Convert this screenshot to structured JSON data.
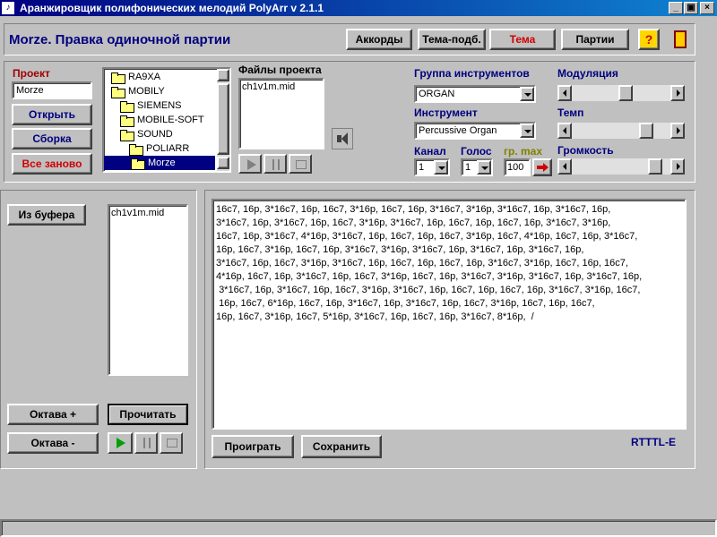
{
  "window": {
    "title": "Аранжировщик полифонических мелодий PolyArr  v 2.1.1",
    "controls": {
      "minimize": "_",
      "restore": "▣",
      "close": "×"
    }
  },
  "header": {
    "title": "Morze. Правка одиночной партии",
    "buttons": {
      "chords": "Аккорды",
      "theme_match": "Тема-подб.",
      "theme": "Тема",
      "parts": "Партии",
      "help": "?"
    }
  },
  "project": {
    "label": "Проект",
    "name_value": "Morze",
    "open": "Открыть",
    "build": "Сборка",
    "restart": "Все заново",
    "tree": [
      "RA9XA",
      "MOBILY",
      "SIEMENS",
      "MOBILE-SOFT",
      "SOUND",
      "POLIARR",
      "Morze"
    ],
    "files_label": "Файлы проекта",
    "files": [
      "ch1v1m.mid"
    ]
  },
  "instrument": {
    "group_label": "Группа инструментов",
    "group_value": "ORGAN",
    "instrument_label": "Инструмент",
    "instrument_value": "Percussive Organ",
    "channel_label": "Канал",
    "channel_value": "1",
    "voice_label": "Голос",
    "voice_value": "1",
    "max_label": "гр. max",
    "max_value": "100",
    "modulation_label": "Модуляция",
    "modulation_level": 0.55,
    "tempo_label": "Темп",
    "tempo_level": 0.8,
    "volume_label": "Громкость",
    "volume_level": 0.9
  },
  "left": {
    "from_buffer": "Из буфера",
    "files": [
      "ch1v1m.mid"
    ],
    "octave_up": "Октава +",
    "octave_down": "Октава -",
    "read": "Прочитать"
  },
  "editor": {
    "text": "16c7, 16p, 3*16c7, 16p, 16c7, 3*16p, 16c7, 16p, 3*16c7, 3*16p, 3*16c7, 16p, 3*16c7, 16p,\n3*16c7, 16p, 3*16c7, 16p, 16c7, 3*16p, 3*16c7, 16p, 16c7, 16p, 16c7, 16p, 3*16c7, 3*16p,\n16c7, 16p, 3*16c7, 4*16p, 3*16c7, 16p, 16c7, 16p, 16c7, 3*16p, 16c7, 4*16p, 16c7, 16p, 3*16c7,\n16p, 16c7, 3*16p, 16c7, 16p, 3*16c7, 3*16p, 3*16c7, 16p, 3*16c7, 16p, 3*16c7, 16p,\n3*16c7, 16p, 16c7, 3*16p, 3*16c7, 16p, 16c7, 16p, 16c7, 16p, 3*16c7, 3*16p, 16c7, 16p, 16c7,\n4*16p, 16c7, 16p, 3*16c7, 16p, 16c7, 3*16p, 16c7, 16p, 3*16c7, 3*16p, 3*16c7, 16p, 3*16c7, 16p,\n 3*16c7, 16p, 3*16c7, 16p, 16c7, 3*16p, 3*16c7, 16p, 16c7, 16p, 16c7, 16p, 3*16c7, 3*16p, 16c7,\n 16p, 16c7, 6*16p, 16c7, 16p, 3*16c7, 16p, 3*16c7, 16p, 16c7, 3*16p, 16c7, 16p, 16c7,\n16p, 16c7, 3*16p, 16c7, 5*16p, 3*16c7, 16p, 16c7, 16p, 3*16c7, 8*16p,  /",
    "play": "Проиграть",
    "save": "Сохранить",
    "format": "RTTTL-E"
  },
  "colors": {
    "title_start": "#000080",
    "title_end": "#1084d0",
    "accent_red": "#a00000",
    "accent_blue": "#000080",
    "olive": "#808000"
  },
  "icons": {
    "speaker": "speaker-icon",
    "exit": "door-icon",
    "help": "help-icon",
    "arrow": "red-arrow-icon"
  }
}
